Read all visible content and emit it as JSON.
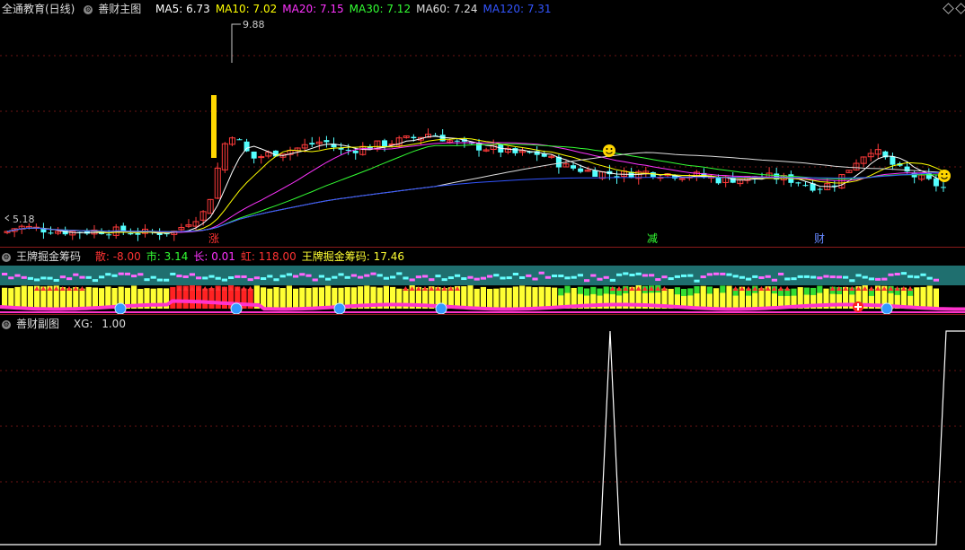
{
  "main": {
    "title": "全通教育(日线)",
    "indicator": "善财主图",
    "ma": [
      {
        "label": "MA5:",
        "value": "6.73",
        "color": "#ffffff"
      },
      {
        "label": "MA10:",
        "value": "7.02",
        "color": "#ffff00"
      },
      {
        "label": "MA20:",
        "value": "7.15",
        "color": "#ff33ff"
      },
      {
        "label": "MA30:",
        "value": "7.12",
        "color": "#33ff33"
      },
      {
        "label": "MA60:",
        "value": "7.24",
        "color": "#dddddd"
      },
      {
        "label": "MA120:",
        "value": "7.31",
        "color": "#3355ff"
      }
    ],
    "high_label": "9.88",
    "low_label": "5.18",
    "markers": [
      "涨",
      "减",
      "财"
    ],
    "colors": {
      "up": "#ff3b3b",
      "down": "#54ffff",
      "bg": "#000000"
    }
  },
  "mid": {
    "indicator": "王牌掘金筹码",
    "fields": [
      {
        "label": "散:",
        "value": "-8.00",
        "color": "#ff3333"
      },
      {
        "label": "市:",
        "value": "3.14",
        "color": "#33ff33"
      },
      {
        "label": "长:",
        "value": "0.01",
        "color": "#ff33ff"
      },
      {
        "label": "虹:",
        "value": "118.00",
        "color": "#ff3333"
      },
      {
        "label": "王牌掘金筹码:",
        "value": "17.46",
        "color": "#ffff33"
      }
    ]
  },
  "sub": {
    "indicator": "善财副图",
    "field": {
      "label": "XG:",
      "value": "1.00",
      "color": "#dddddd"
    },
    "chart_data": {
      "type": "line",
      "series": [
        {
          "name": "XG",
          "values": [
            0,
            1,
            0,
            1
          ]
        }
      ],
      "ylim": [
        0,
        1
      ]
    }
  }
}
